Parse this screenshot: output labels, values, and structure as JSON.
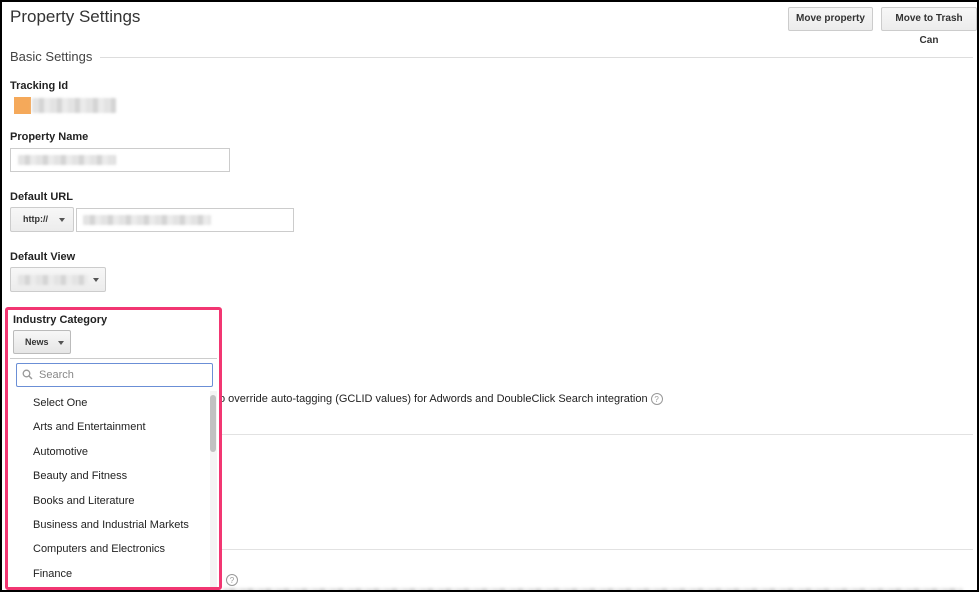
{
  "header": {
    "title": "Property Settings",
    "move_label": "Move property",
    "trash_label": "Move to Trash Can"
  },
  "basic": {
    "section_title": "Basic Settings",
    "tracking_label": "Tracking Id",
    "property_name_label": "Property Name",
    "default_url_label": "Default URL",
    "protocol": "http://",
    "default_view_label": "Default View",
    "industry_label": "Industry Category"
  },
  "dropdown": {
    "selected": "News",
    "search_placeholder": "Search",
    "options": [
      "Select One",
      "Arts and Entertainment",
      "Automotive",
      "Beauty and Fitness",
      "Books and Literature",
      "Business and Industrial Markets",
      "Computers and Electronics",
      "Finance"
    ]
  },
  "background": {
    "autotag_text": "o override auto-tagging (GCLID values) for Adwords and DoubleClick Search integration",
    "help_glyph": "?"
  },
  "colors": {
    "highlight": "#f23672",
    "focus": "#6b8fd6",
    "tracking_square": "#f5a95a"
  }
}
